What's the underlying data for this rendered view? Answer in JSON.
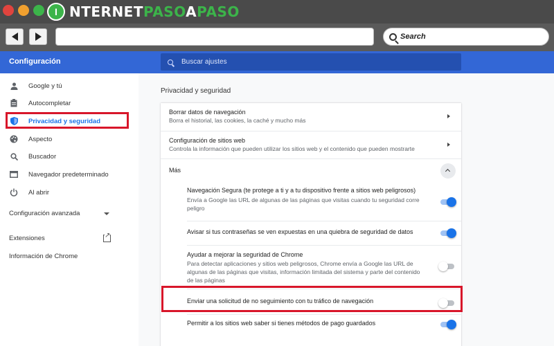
{
  "browser": {
    "brand_prefix": "I",
    "brand_white_1": "NTERNET",
    "brand_green": "PASO",
    "brand_a": "A",
    "brand_paso": "PASO",
    "search_label": "Search",
    "colors": {
      "close": "#e0443e",
      "minimize": "#f0a02f",
      "maximize": "#3cb44a"
    }
  },
  "header": {
    "title": "Configuración",
    "search_placeholder": "Buscar ajustes",
    "accent": "#3367d6"
  },
  "sidebar": {
    "items": [
      {
        "label": "Google y tú",
        "icon": "person-icon"
      },
      {
        "label": "Autocompletar",
        "icon": "clipboard-icon"
      },
      {
        "label": "Privacidad y seguridad",
        "icon": "shield-icon"
      },
      {
        "label": "Aspecto",
        "icon": "palette-icon"
      },
      {
        "label": "Buscador",
        "icon": "search-icon"
      },
      {
        "label": "Navegador predeterminado",
        "icon": "browser-icon"
      },
      {
        "label": "Al abrir",
        "icon": "power-icon"
      }
    ],
    "advanced": "Configuración avanzada",
    "extensions": "Extensiones",
    "about": "Información de Chrome"
  },
  "main": {
    "section_title": "Privacidad y seguridad",
    "rows": [
      {
        "title": "Borrar datos de navegación",
        "subtitle": "Borra el historial, las cookies, la caché y mucho más"
      },
      {
        "title": "Configuración de sitios web",
        "subtitle": "Controla la información que pueden utilizar los sitios web y el contenido que pueden mostrarte"
      }
    ],
    "more_label": "Más",
    "toggles": [
      {
        "title": "Navegación Segura (te protege a ti y a tu dispositivo frente a sitios web peligrosos)",
        "desc": "Envía a Google las URL de algunas de las páginas que visitas cuando tu seguridad corre peligro",
        "on": true
      },
      {
        "title": "Avisar si tus contraseñas se ven expuestas en una quiebra de seguridad de datos",
        "desc": "",
        "on": true
      },
      {
        "title": "Ayudar a mejorar la seguridad de Chrome",
        "desc": "Para detectar aplicaciones y sitios web peligrosos, Chrome envía a Google las URL de algunas de las páginas que visitas, información limitada del sistema y parte del contenido de las páginas",
        "on": false
      },
      {
        "title": "Enviar una solicitud de no seguimiento con tu tráfico de navegación",
        "desc": "",
        "on": false
      },
      {
        "title": "Permitir a los sitios web saber si tienes métodos de pago guardados",
        "desc": "",
        "on": true
      }
    ]
  }
}
